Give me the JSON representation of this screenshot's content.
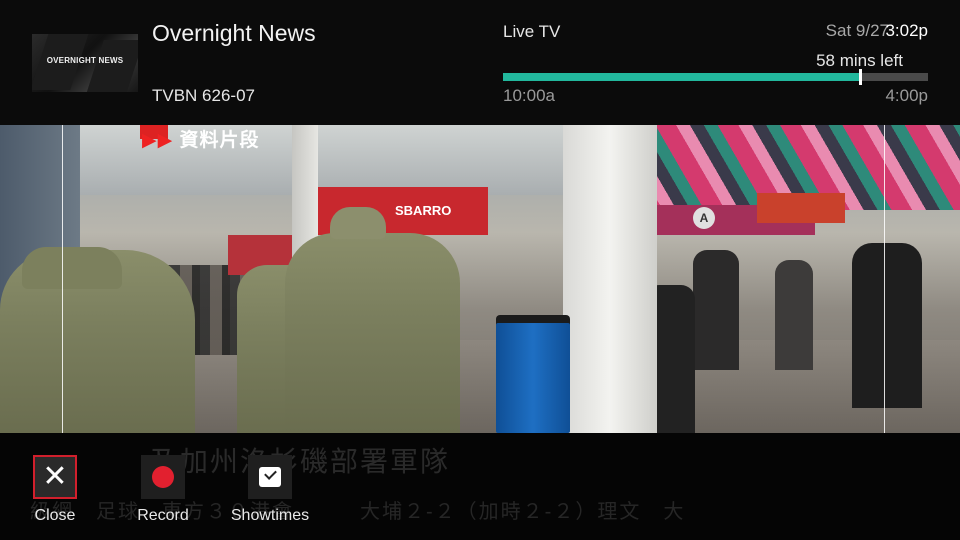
{
  "header": {
    "thumbnail_text": "OVERNIGHT NEWS",
    "program_title": "Overnight News",
    "channel": "TVBN 626-07",
    "source": "Live TV",
    "date": "Sat 9/27",
    "time": "3:02p",
    "remaining": "58 mins left",
    "start_time": "10:00a",
    "end_time": "4:00p",
    "progress": 0.84,
    "progress_color": "#22b89d"
  },
  "video": {
    "sign_text": "資料片段",
    "store_sign": "SBARRO",
    "gate_badge": "A"
  },
  "ticker": {
    "line1": "及加州洛杉磯部署軍隊",
    "line2": "級網　足球　東方３０港會　　　大埔２-２（加時２-２）理文　大"
  },
  "actions": [
    {
      "label": "Close",
      "icon": "close-icon",
      "focused": true
    },
    {
      "label": "Record",
      "icon": "record-icon",
      "focused": false
    },
    {
      "label": "Showtimes",
      "icon": "calendar-icon",
      "focused": false
    }
  ],
  "colors": {
    "focus_border": "#d11f2c",
    "record": "#e2202f"
  }
}
